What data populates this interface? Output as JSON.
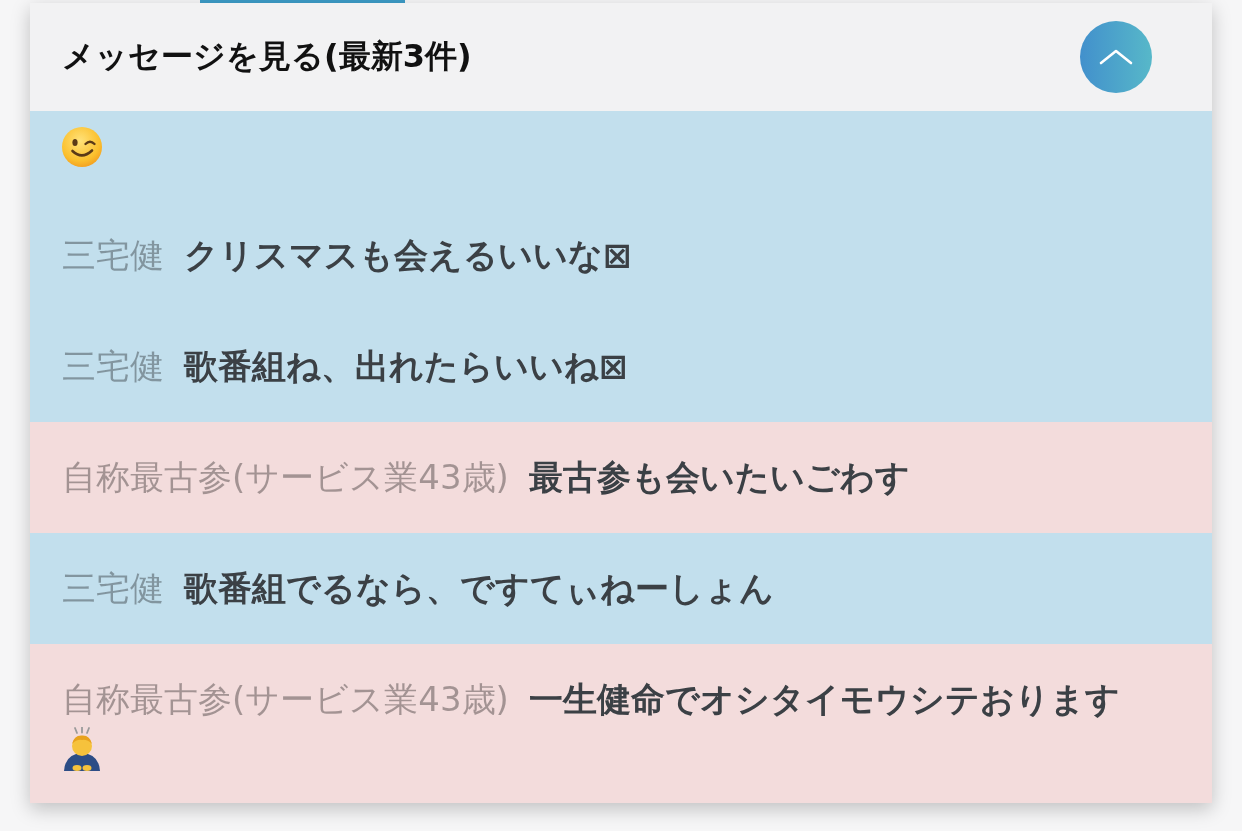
{
  "header": {
    "title": "メッセージを見る(最新3件)",
    "expanded": true
  },
  "messages": [
    {
      "color": "#c2dfed",
      "emoji": {
        "kind": "wink"
      }
    },
    {
      "color": "#c2dfed",
      "author": "三宅健",
      "body": "クリスマスも会えるいいな⊠"
    },
    {
      "color": "#c2dfed",
      "author": "三宅健",
      "body": "歌番組ね、出れたらいいね⊠"
    },
    {
      "color": "#f3dcdc",
      "author": "自称最古参(サービス業43歳)",
      "body": "最古参も会いたいごわす"
    },
    {
      "color": "#c2dfed",
      "author": "三宅健",
      "body": "歌番組でるなら、ですてぃねーしょん"
    },
    {
      "color": "#f3dcdc",
      "author": "自称最古参(サービス業43歳)",
      "body": "一生健命でオシタイモウシテおります",
      "emoji": {
        "kind": "bow"
      }
    }
  ]
}
